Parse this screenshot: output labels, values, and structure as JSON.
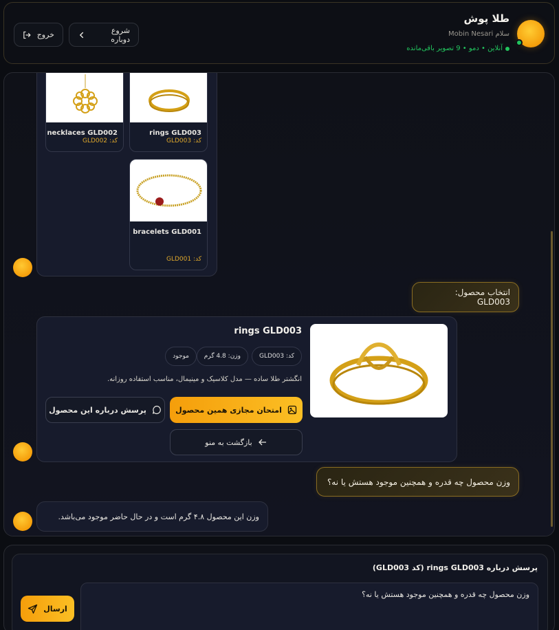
{
  "header": {
    "brand": "طلا پوش",
    "greeting": "سلام Mobin Nesari",
    "status": "آنلاین • دمو • 9 تصویر باقی‌مانده",
    "restart_label": "شروع دوباره",
    "logout_label": "خروج"
  },
  "product_grid": {
    "items": [
      {
        "name": "rings GLD003",
        "code": "کد: GLD003"
      },
      {
        "name": "necklaces GLD002",
        "code": "کد: GLD002"
      },
      {
        "name": "bracelets GLD001",
        "code": "کد: GLD001"
      }
    ]
  },
  "messages": {
    "select_product": "انتخاب محصول: GLD003",
    "user_question": "وزن محصول چه قدره و همچنین موجود هستش یا نه؟",
    "bot_answer": "وزن این محصول ۴.۸ گرم است و در حال حاضر موجود می‌باشد."
  },
  "detail": {
    "title": "rings GLD003",
    "code_chip": "کد: GLD003",
    "weight_chip": "وزن: 4.8 گرم",
    "stock_chip": "موجود",
    "description": "انگشتر طلا ساده — مدل کلاسیک و مینیمال، مناسب استفاده روزانه.",
    "try_on_label": "امتحان مجازی همین محصول",
    "ask_label": "پرسش درباره این محصول",
    "back_label": "بازگشت به منو"
  },
  "composer": {
    "title": "پرسش درباره rings GLD003 (کد GLD003)",
    "input_value": "وزن محصول چه قدره و همچنین موجود هستش یا نه؟",
    "send_label": "ارسال"
  },
  "colors": {
    "accent": "#f59e0b",
    "online": "#22c55e",
    "code": "#e0a92c"
  }
}
